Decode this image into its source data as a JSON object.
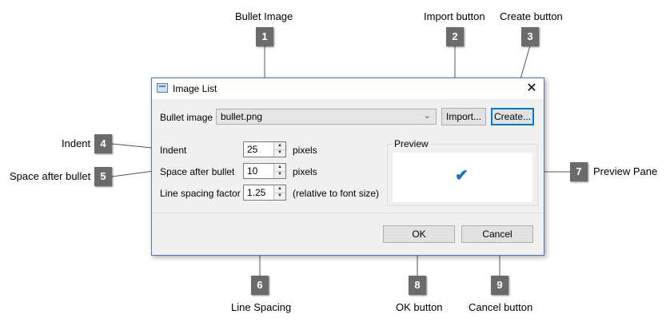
{
  "callouts": {
    "bullet_image": {
      "num": "1",
      "label": "Bullet Image"
    },
    "import_button": {
      "num": "2",
      "label": "Import button"
    },
    "create_button": {
      "num": "3",
      "label": "Create button"
    },
    "indent": {
      "num": "4",
      "label": "Indent"
    },
    "space_after_bullet": {
      "num": "5",
      "label": "Space after bullet"
    },
    "line_spacing": {
      "num": "6",
      "label": "Line Spacing"
    },
    "preview_pane": {
      "num": "7",
      "label": "Preview Pane"
    },
    "ok_button": {
      "num": "8",
      "label": "OK button"
    },
    "cancel_button": {
      "num": "9",
      "label": "Cancel button"
    }
  },
  "dialog": {
    "title": "Image List",
    "close_glyph": "✕",
    "bullet_image_label": "Bullet image",
    "bullet_image_value": "bullet.png",
    "combo_arrow": "⌄",
    "import_label": "Import...",
    "create_label": "Create...",
    "indent_label": "Indent",
    "indent_value": "25",
    "indent_unit": "pixels",
    "space_label": "Space after bullet",
    "space_value": "10",
    "space_unit": "pixels",
    "line_spacing_label": "Line spacing factor",
    "line_spacing_value": "1.25",
    "line_spacing_note": "(relative to font size)",
    "preview_title": "Preview",
    "preview_glyph": "✔",
    "ok_label": "OK",
    "cancel_label": "Cancel"
  },
  "icons": {
    "spin_up": "▲",
    "spin_down": "▼"
  },
  "colors": {
    "badge": "#6b6b6b",
    "accent": "#0078d7",
    "check": "#1a70c4"
  }
}
